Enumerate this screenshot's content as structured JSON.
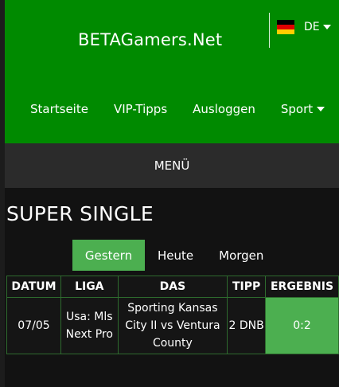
{
  "header": {
    "site_title": "BETAGamers.Net",
    "language": {
      "code": "DE",
      "flag_colors": [
        "#000000",
        "#dd0000",
        "#ffce00"
      ]
    },
    "nav": [
      {
        "label": "Startseite"
      },
      {
        "label": "VIP-Tipps"
      },
      {
        "label": "Ausloggen"
      },
      {
        "label": "Sport",
        "has_dropdown": true
      }
    ]
  },
  "menu": {
    "label": "MENÜ"
  },
  "section": {
    "title": "SUPER SINGLE"
  },
  "tabs": [
    {
      "label": "Gestern",
      "active": true
    },
    {
      "label": "Heute",
      "active": false
    },
    {
      "label": "Morgen",
      "active": false
    }
  ],
  "table": {
    "headers": [
      "DATUM",
      "LIGA",
      "DAS",
      "TIPP",
      "ERGEBNIS"
    ],
    "rows": [
      {
        "datum": "07/05",
        "liga": "Usa: Mls Next Pro",
        "das": "Sporting Kansas City II vs Ventura County",
        "tipp": "2 DNB",
        "ergebnis": "0:2"
      }
    ]
  },
  "colors": {
    "header_green": "#008a00",
    "accent_green": "#4caf50",
    "menu_bar": "#2b2b2b",
    "background": "#121212"
  }
}
